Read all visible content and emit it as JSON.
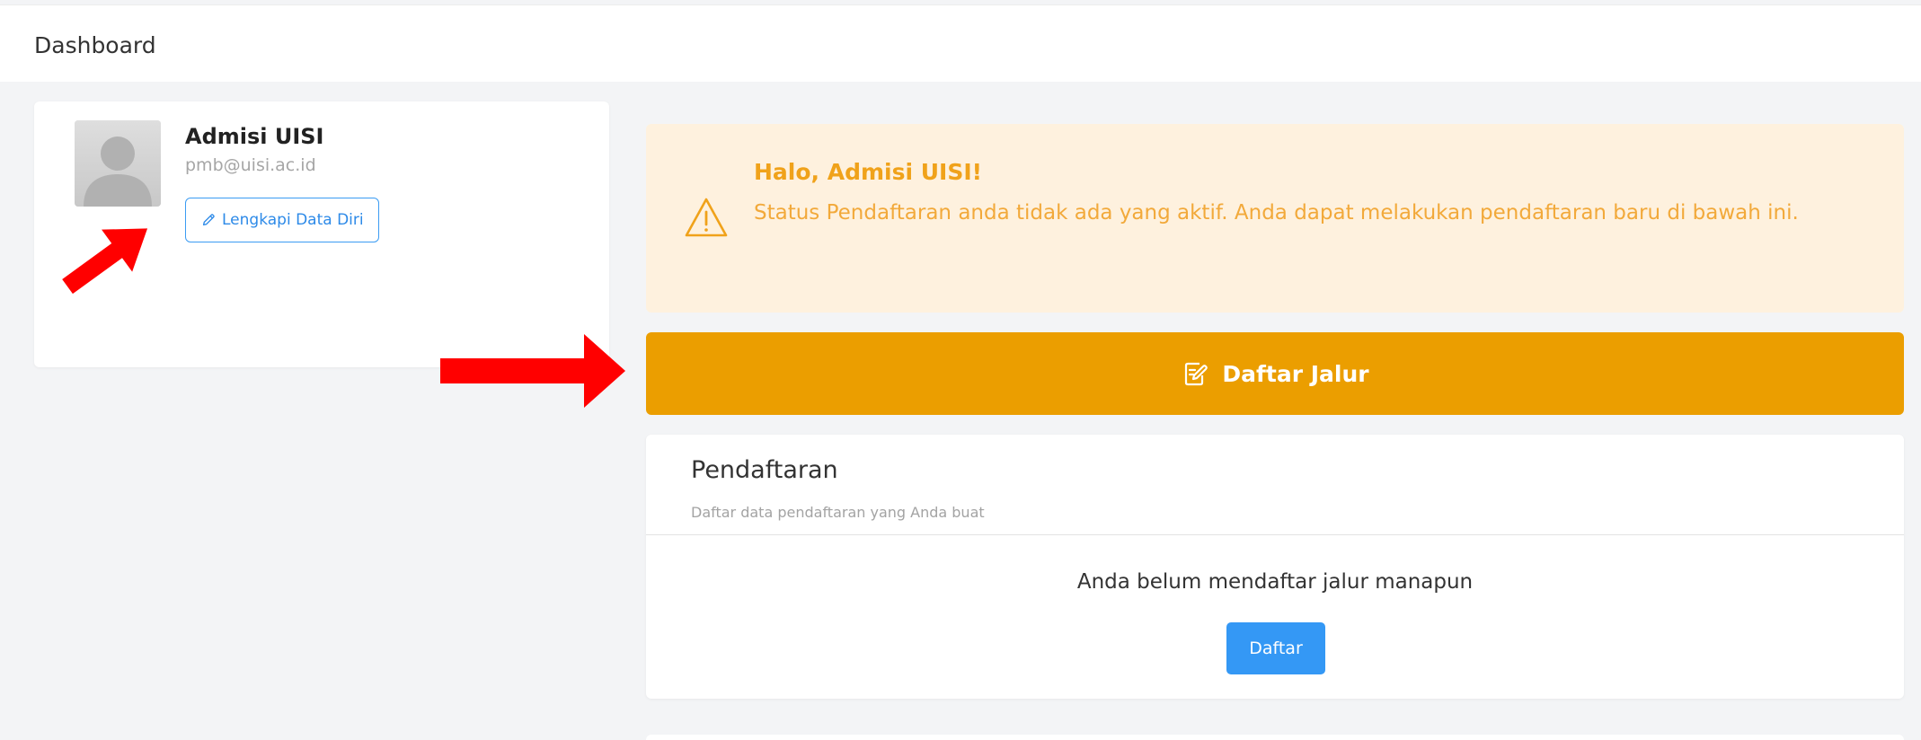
{
  "header": {
    "title": "Dashboard"
  },
  "profile": {
    "name": "Admisi UISI",
    "email": "pmb@uisi.ac.id",
    "complete_button_label": "Lengkapi Data Diri",
    "avatar_icon": "avatar-placeholder-icon"
  },
  "alert": {
    "title": "Halo, Admisi UISI!",
    "message": "Status Pendaftaran anda tidak ada yang aktif. Anda dapat melakukan pendaftaran baru di bawah ini.",
    "icon": "warning-triangle-icon",
    "background_color": "#fef1de",
    "text_color": "#f0a21a"
  },
  "register_path": {
    "button_label": "Daftar Jalur",
    "icon": "edit-document-icon",
    "color": "#eb9e00"
  },
  "registration": {
    "title": "Pendaftaran",
    "subtitle": "Daftar data pendaftaran yang Anda buat",
    "empty_message": "Anda belum mendaftar jalur manapun",
    "button_label": "Daftar",
    "button_color": "#3498f5"
  },
  "annotations": {
    "arrow_color": "#ff0000"
  }
}
